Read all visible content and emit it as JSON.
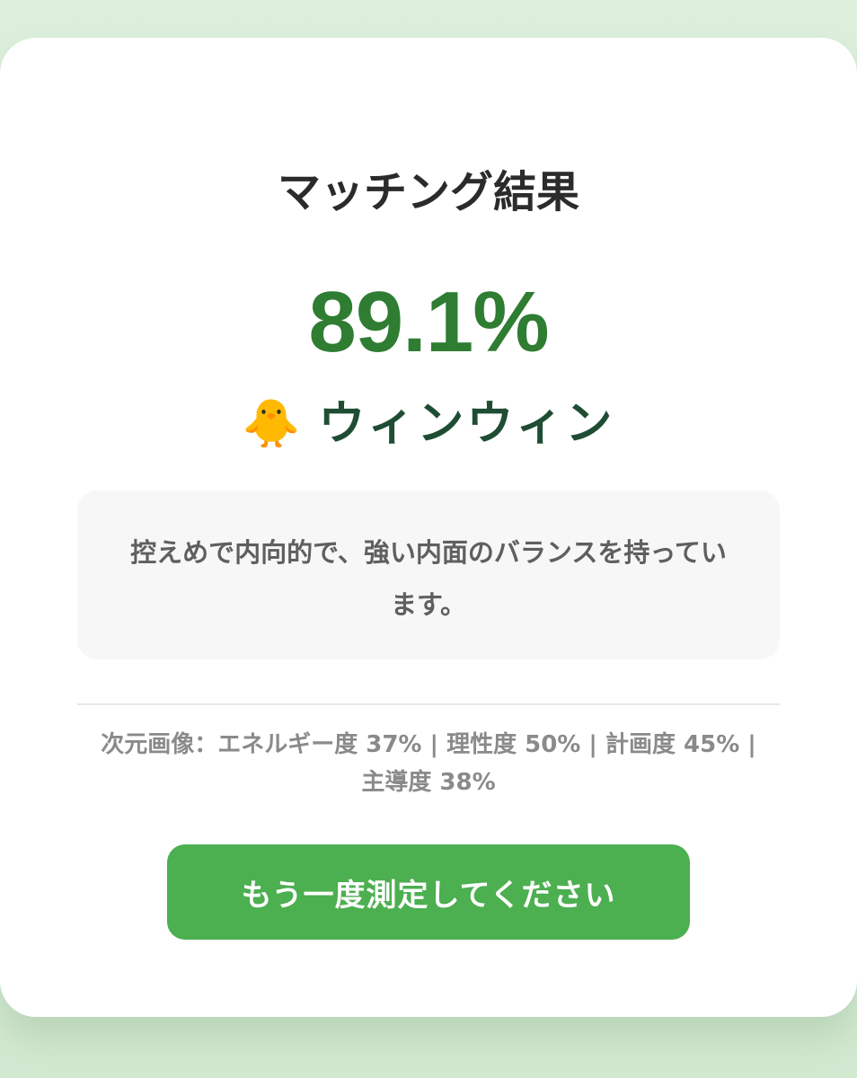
{
  "result": {
    "title": "マッチング結果",
    "score": "89.1%",
    "type_icon": "🐥",
    "type_icon_name": "baby-chick-icon",
    "type_name": "ウィンウィン",
    "description": "控えめで内向的で、強い内面のバランスを持っています。",
    "dimensions_text": "次元画像：エネルギー度 37% | 理性度 50% | 計画度 45% | 主導度 38%",
    "dimensions": [
      {
        "label": "エネルギー度",
        "value": 37
      },
      {
        "label": "理性度",
        "value": 50
      },
      {
        "label": "計画度",
        "value": 45
      },
      {
        "label": "主導度",
        "value": 38
      }
    ],
    "retry_label": "もう一度測定してください"
  },
  "colors": {
    "score": "#2e7d32",
    "type_name": "#1f4d33",
    "button": "#4caf50",
    "background": "#dcefdc"
  }
}
